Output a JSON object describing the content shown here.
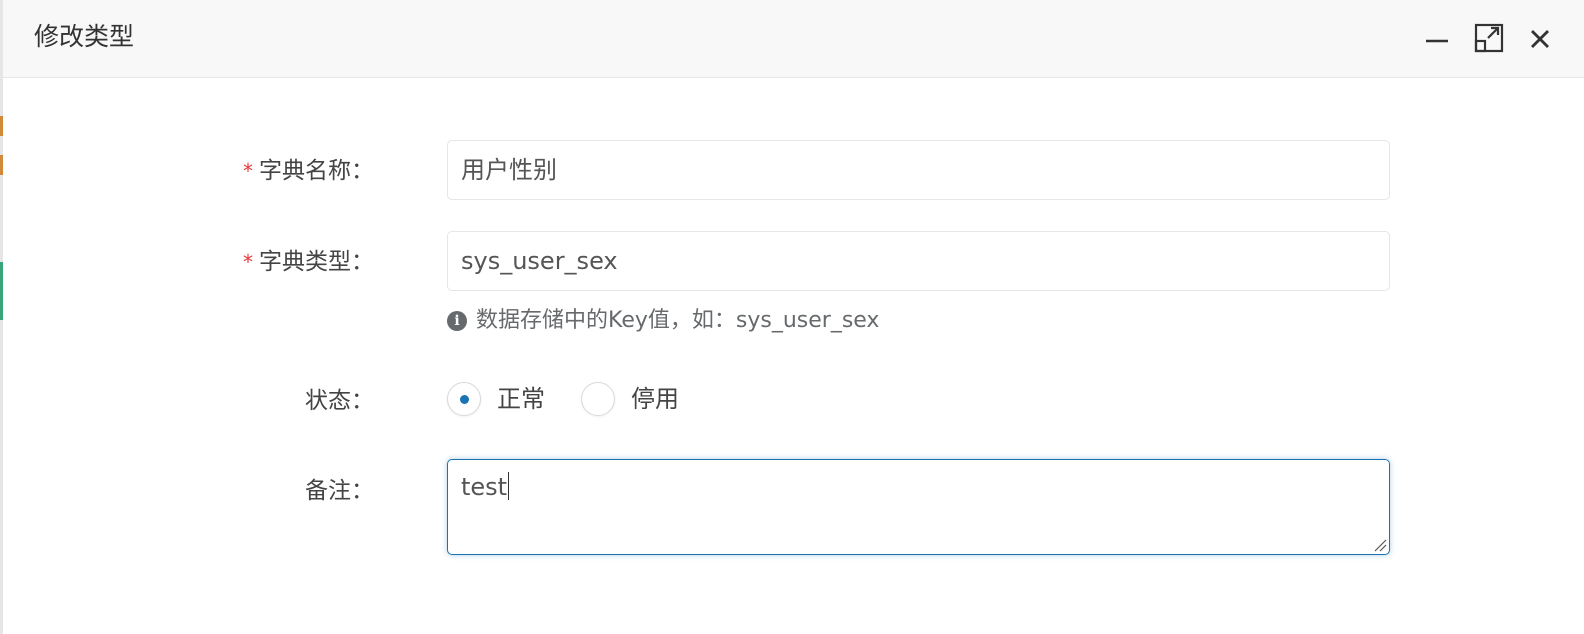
{
  "dialog": {
    "title": "修改类型",
    "controls": {
      "minimize_icon": "minimize-icon",
      "maximize_icon": "maximize-icon",
      "close_icon": "close-icon"
    }
  },
  "form": {
    "required_mark": "*",
    "dict_name": {
      "label": "字典名称：",
      "value": "用户性别"
    },
    "dict_type": {
      "label": "字典类型：",
      "value": "sys_user_sex",
      "help_icon": "info-icon",
      "help_text": "数据存储中的Key值，如：sys_user_sex"
    },
    "status": {
      "label": "状态：",
      "options": [
        {
          "label": "正常",
          "checked": true
        },
        {
          "label": "停用",
          "checked": false
        }
      ]
    },
    "remark": {
      "label": "备注：",
      "value": "test"
    }
  },
  "colors": {
    "accent": "#1a74b4",
    "required": "#e4393c",
    "titlebar_bg": "#f8f8f8"
  }
}
